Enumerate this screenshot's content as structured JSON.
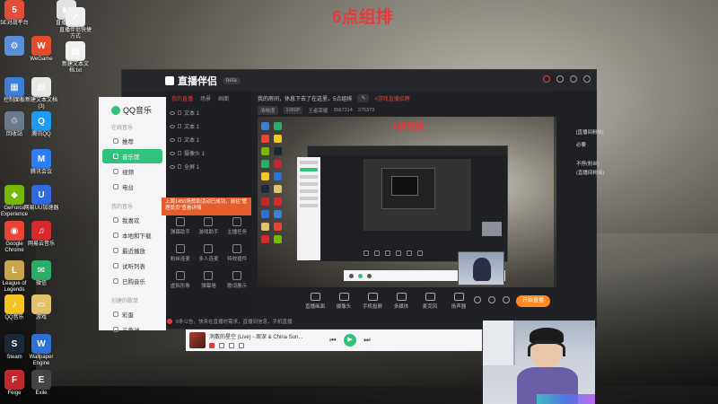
{
  "overlay_title": "6点组排",
  "desktop_icons": [
    {
      "name": "recycle-icon",
      "label": "",
      "color": "#5a8fd8",
      "glyph": "⚙"
    },
    {
      "name": "controlpanel-icon",
      "label": "控制面板",
      "color": "#3d7fd6",
      "glyph": "▦"
    },
    {
      "name": "pc-icon",
      "label": "回收站",
      "color": "#6a7a8a",
      "glyph": "♲"
    },
    {
      "name": "geforce-icon",
      "label": "GeForce Experience",
      "color": "#76b900",
      "glyph": "◆"
    },
    {
      "name": "chrome-icon",
      "label": "Google Chrome",
      "color": "#e84335",
      "glyph": "◉"
    },
    {
      "name": "lol-icon",
      "label": "League of Legends",
      "color": "#c8a44a",
      "glyph": "L"
    },
    {
      "name": "qqmusic-icon",
      "label": "QQ音乐",
      "color": "#f3c623",
      "glyph": "♪"
    },
    {
      "name": "steam-icon",
      "label": "Steam",
      "color": "#1b2838",
      "glyph": "S"
    },
    {
      "name": "feige-icon",
      "label": "Feige",
      "color": "#c0282d",
      "glyph": "F"
    },
    {
      "name": "wegame-icon",
      "label": "WeGame",
      "color": "#e44b2c",
      "glyph": "W"
    },
    {
      "name": "newtext-icon",
      "label": "新建文本文档 (3)",
      "color": "#e8e8e8",
      "glyph": "▤"
    },
    {
      "name": "tencentqq-icon",
      "label": "腾讯QQ",
      "color": "#1e9bf0",
      "glyph": "Q"
    },
    {
      "name": "meeting-icon",
      "label": "腾讯会议",
      "color": "#2e7cf6",
      "glyph": "M"
    },
    {
      "name": "netease-uu-icon",
      "label": "网易UU加速器",
      "color": "#2f6ae0",
      "glyph": "U"
    },
    {
      "name": "netease-music-icon",
      "label": "网易云音乐",
      "color": "#d6292c",
      "glyph": "♫"
    },
    {
      "name": "wechat-icon",
      "label": "微信",
      "color": "#2aae67",
      "glyph": "✉"
    },
    {
      "name": "folder-icon",
      "label": "游戏",
      "color": "#e3c06a",
      "glyph": "▭"
    },
    {
      "name": "wallpaper-icon",
      "label": "Wallpaper Engine",
      "color": "#2d72d2",
      "glyph": "W"
    },
    {
      "name": "exile-icon",
      "label": "Exile",
      "color": "#444",
      "glyph": "E"
    },
    {
      "name": "live-icon",
      "label": "直播伴侣",
      "color": "#e1e1e1",
      "glyph": "▶"
    },
    {
      "name": "shortcut-icon",
      "label": "直播伴侣快捷方式",
      "color": "#f0f0f0",
      "glyph": "↗"
    },
    {
      "name": "newtext2-icon",
      "label": "新建文本文档.txt",
      "color": "#f0f0f0",
      "glyph": "▤"
    },
    {
      "name": "5e-icon",
      "label": "5E对战平台",
      "color": "#e04e39",
      "glyph": "5"
    }
  ],
  "app": {
    "name": "直播伴侣",
    "version": "beta",
    "tabs": [
      "我的直播",
      "场景",
      "画面"
    ],
    "scenes": [
      "文本 1",
      "文本 1",
      "文本 1",
      "摄像头 1",
      "全屏 1"
    ],
    "notice": "上周1450场赞助活动已成功，前往“管理员页”查看详情",
    "tools": [
      "弹幕助手",
      "游戏助手",
      "主播任务",
      "粉丝连麦",
      "多人连麦",
      "特效插件",
      "虚拟形象",
      "弹幕墙",
      "歌词展示"
    ],
    "preview_title": "我的房间，休息下去了在这里，5点组排",
    "preview_tag": "#游戏直播招聘",
    "preview_subtags": [
      "清晰度",
      "1080P",
      "王者荣耀",
      "3567314",
      "275373"
    ],
    "bottom_tools": [
      "直播画面",
      "摄像头",
      "手机投屏",
      "多媒体",
      "麦克风",
      "扬声器"
    ],
    "start_button": "开始直播",
    "status": "5条公告，快来在直播时需求，直播间信息，手机直播"
  },
  "qq_music": {
    "logo": "QQ音乐",
    "section_online": "在线音乐",
    "items_online": [
      "推荐",
      "音乐馆",
      "视频",
      "电台"
    ],
    "section_mine": "我的音乐",
    "items_mine": [
      "我喜欢",
      "本地和下载",
      "最近播放",
      "试听列表",
      "已购音乐"
    ],
    "section_created": "创建的歌单",
    "created": [
      "彩蛋",
      "三角洲"
    ]
  },
  "player": {
    "song": "消散的星空 (Live) - 周深 & China Sun...",
    "controls": [
      "prev",
      "play",
      "next"
    ]
  },
  "right_snippets": [
    "[直播间粉丝]",
    "必要",
    "不停(粉丝)",
    "(直播间粉丝)"
  ],
  "colors": {
    "accent": "#e53b3b",
    "start": "#ff8a1f",
    "qq_green": "#31c27c"
  }
}
